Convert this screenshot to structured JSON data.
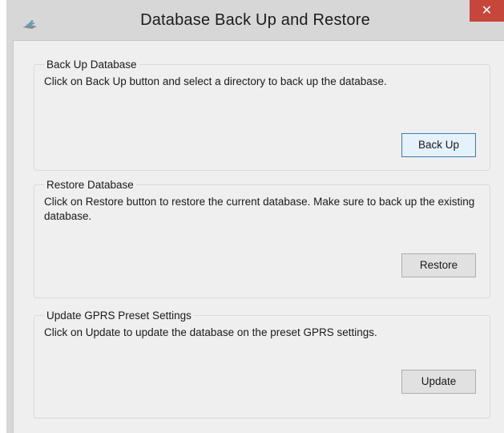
{
  "window": {
    "title": "Database Back Up and Restore",
    "close_glyph": "✕"
  },
  "backup_group": {
    "title": "Back Up Database",
    "description": "Click on Back Up button and select a directory to back up the database.",
    "button_label": "Back Up"
  },
  "restore_group": {
    "title": "Restore Database",
    "description": "Click on Restore button to restore the current database. Make sure to back up the existing database.",
    "button_label": "Restore"
  },
  "update_group": {
    "title": "Update GPRS Preset Settings",
    "description": "Click on Update to update the database on the preset GPRS settings.",
    "button_label": "Update"
  },
  "colors": {
    "titlebar": "#d7d7d7",
    "close_button": "#c7463c",
    "client_background": "#efefef",
    "focused_button_border": "#3c7fb1"
  }
}
